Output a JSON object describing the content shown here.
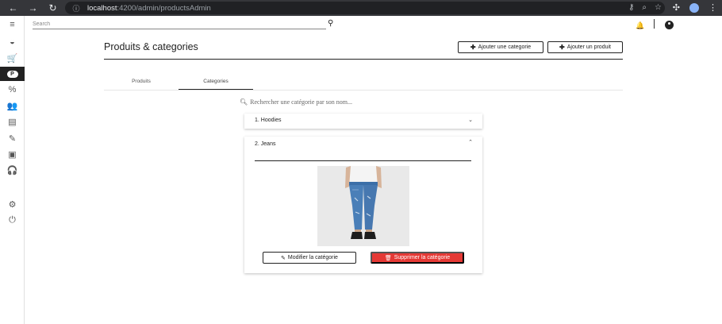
{
  "browser": {
    "url_host": "localhost",
    "url_path": ":4200/admin/productsAdmin",
    "nav_icons": [
      "back-arrow",
      "forward-arrow",
      "reload"
    ],
    "omnibox_icons": [
      "key-icon",
      "zoom-icon",
      "star-icon"
    ],
    "extension_icons": [
      "puzzle-icon",
      "profile-avatar",
      "more-icon"
    ]
  },
  "sidebar": {
    "items": [
      {
        "icon": "menu-icon",
        "glyph": "≡"
      },
      {
        "icon": "dashboard-icon",
        "glyph": "◒"
      },
      {
        "icon": "cart-icon",
        "glyph": "⛟"
      },
      {
        "icon": "products-icon",
        "glyph": "P",
        "active": true
      },
      {
        "icon": "percent-icon",
        "glyph": "%"
      },
      {
        "icon": "users-icon",
        "glyph": "👥"
      },
      {
        "icon": "store-icon",
        "glyph": "▤"
      },
      {
        "icon": "brush-icon",
        "glyph": "✎"
      },
      {
        "icon": "save-icon",
        "glyph": "▣"
      },
      {
        "icon": "headset-icon",
        "glyph": "🎧"
      },
      {
        "icon": "settings-icon",
        "glyph": "⚙"
      },
      {
        "icon": "power-icon",
        "glyph": "⏻"
      }
    ]
  },
  "topbar": {
    "search_placeholder": "Search"
  },
  "page": {
    "title": "Produits & categories",
    "add_category_label": "Ajouter une categorie",
    "add_product_label": "Ajouter un produit"
  },
  "tabs": [
    {
      "label": "Produits",
      "active": false
    },
    {
      "label": "Categories",
      "active": true
    }
  ],
  "category_search": {
    "placeholder": "Rechercher une catégorie par son nom..."
  },
  "categories": [
    {
      "label": "1. Hoodies",
      "expanded": false
    },
    {
      "label": "2. Jeans",
      "expanded": true,
      "edit_label": "Modifier la catégorie",
      "delete_label": "Supprimer la catégorie"
    }
  ],
  "colors": {
    "accent_dark": "#222222",
    "delete_red": "#e53935",
    "chrome_bg": "#35363a"
  }
}
